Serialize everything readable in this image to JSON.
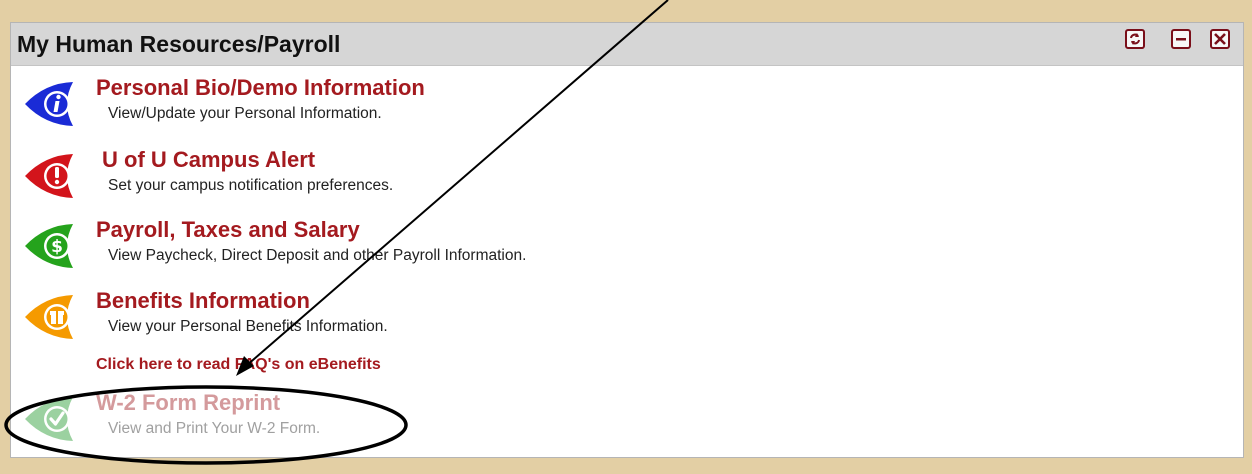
{
  "panel": {
    "title": "My Human Resources/Payroll",
    "controls": [
      "refresh-icon",
      "minimize-icon",
      "close-icon"
    ]
  },
  "items": [
    {
      "title": "Personal Bio/Demo Information",
      "description": "View/Update your Personal Information.",
      "icon": "info-icon",
      "color": "#1a2bd6"
    },
    {
      "title": "U of U Campus Alert",
      "description": "Set your campus notification preferences.",
      "icon": "alert-icon",
      "color": "#d3141b"
    },
    {
      "title": "Payroll, Taxes and Salary",
      "description": "View Paycheck, Direct Deposit and other Payroll Information.",
      "icon": "dollar-icon",
      "color": "#25a31c"
    },
    {
      "title": "Benefits Information",
      "description": "View your Personal Benefits Information.",
      "icon": "gift-icon",
      "color": "#f59a00"
    },
    {
      "title": "W-2 Form Reprint",
      "description": "View and Print Your W-2 Form.",
      "icon": "checkmark-icon",
      "color": "#3aa444"
    }
  ],
  "faq_link": "Click here to read FAQ's on eBenefits",
  "colors": {
    "background": "#e3cfa4",
    "header": "#d6d6d6",
    "link": "#a41a1f"
  }
}
